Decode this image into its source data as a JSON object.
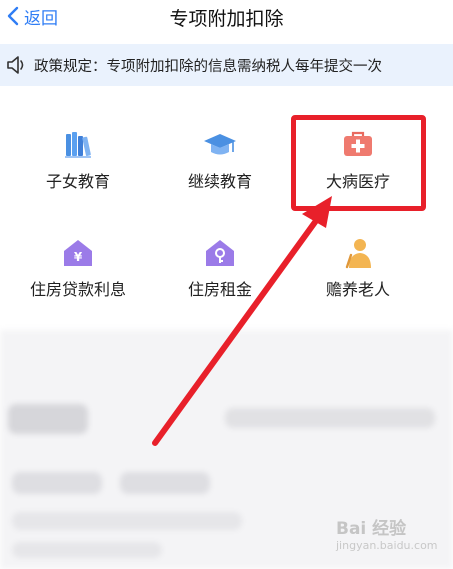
{
  "nav": {
    "back_label": "返回",
    "title": "专项附加扣除"
  },
  "notice": {
    "text": "政策规定：专项附加扣除的信息需纳税人每年提交一次"
  },
  "items": [
    {
      "label": "子女教育",
      "icon": "books-icon"
    },
    {
      "label": "继续教育",
      "icon": "graduation-cap-icon"
    },
    {
      "label": "大病医疗",
      "icon": "medical-kit-icon"
    },
    {
      "label": "住房贷款利息",
      "icon": "house-yen-icon"
    },
    {
      "label": "住房租金",
      "icon": "house-key-icon"
    },
    {
      "label": "赡养老人",
      "icon": "elderly-person-icon"
    }
  ],
  "colors": {
    "accent": "#2f7df5",
    "highlight": "#e8202a",
    "notice_bg": "#eaf2fd"
  },
  "watermark": {
    "text_big": "Bai 经验",
    "text_small": "jingyan.baidu.com"
  }
}
